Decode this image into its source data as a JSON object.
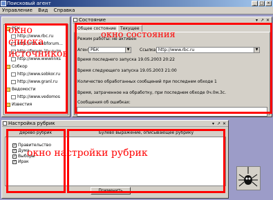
{
  "window": {
    "title": "Поисковый агент"
  },
  "menu": [
    "Управление",
    "Вид",
    "Справка"
  ],
  "sources_window": {
    "overlay_label": "окно списка источников",
    "tree": [
      {
        "label": "РБК",
        "type": "folder"
      },
      {
        "label": "http://www.rbc.ru",
        "type": "doc"
      },
      {
        "label": "http://rbc.webforum...",
        "type": "doc"
      },
      {
        "label": "http://forum.1tv.ru/m",
        "type": "doc"
      },
      {
        "label": "http://www.wwwlinks",
        "type": "doc"
      },
      {
        "label": "Собкор",
        "type": "folder"
      },
      {
        "label": "http://www.sobkor.ru",
        "type": "doc"
      },
      {
        "label": "http://www.granl.ru",
        "type": "doc"
      },
      {
        "label": "Ведомости",
        "type": "folder"
      },
      {
        "label": "http://www.vedomos",
        "type": "doc"
      },
      {
        "label": "Известия",
        "type": "folder"
      }
    ]
  },
  "state_window": {
    "title": "Состояние",
    "tabs": [
      "Общее состояние",
      "Текущее"
    ],
    "overlay_label": "окно состояния",
    "mode_label": "Режим работы: не активен",
    "agent_label": "Агент",
    "agent_value": "РБК",
    "link_label": "Ссылка",
    "link_value": "http://www.rbc.ru",
    "last_run": "Время последнего запуска 19.05.2003 20:22",
    "next_run": "Время следующего запуска 19.05.2003 21:00",
    "processed": "Количество обработанных сообщений при последнем обходе 1",
    "time_spent": "Время, затраченное на обработку, при последнем обходе 0ч.0м.3с.",
    "errors_label": "Сообщения об ошибках:"
  },
  "rubric_window": {
    "title": "Настройка рубрик",
    "tree_header": "Дерево рубрик",
    "expr_header": "Булево выражение, описывающее рубрику",
    "overlay_label": "окно настройки рубрик",
    "items": [
      "Правительство",
      "Дума",
      "Выборы",
      "Ирак"
    ],
    "apply_label": "Применить"
  },
  "colors": {
    "annotation": "#ff0000",
    "desktop": "#9c9cc8",
    "panel": "#d4d0c8"
  },
  "icons": [
    "app-icon",
    "minimize-icon",
    "maximize-icon",
    "close-icon",
    "folder-icon",
    "document-icon",
    "spider-icon"
  ]
}
